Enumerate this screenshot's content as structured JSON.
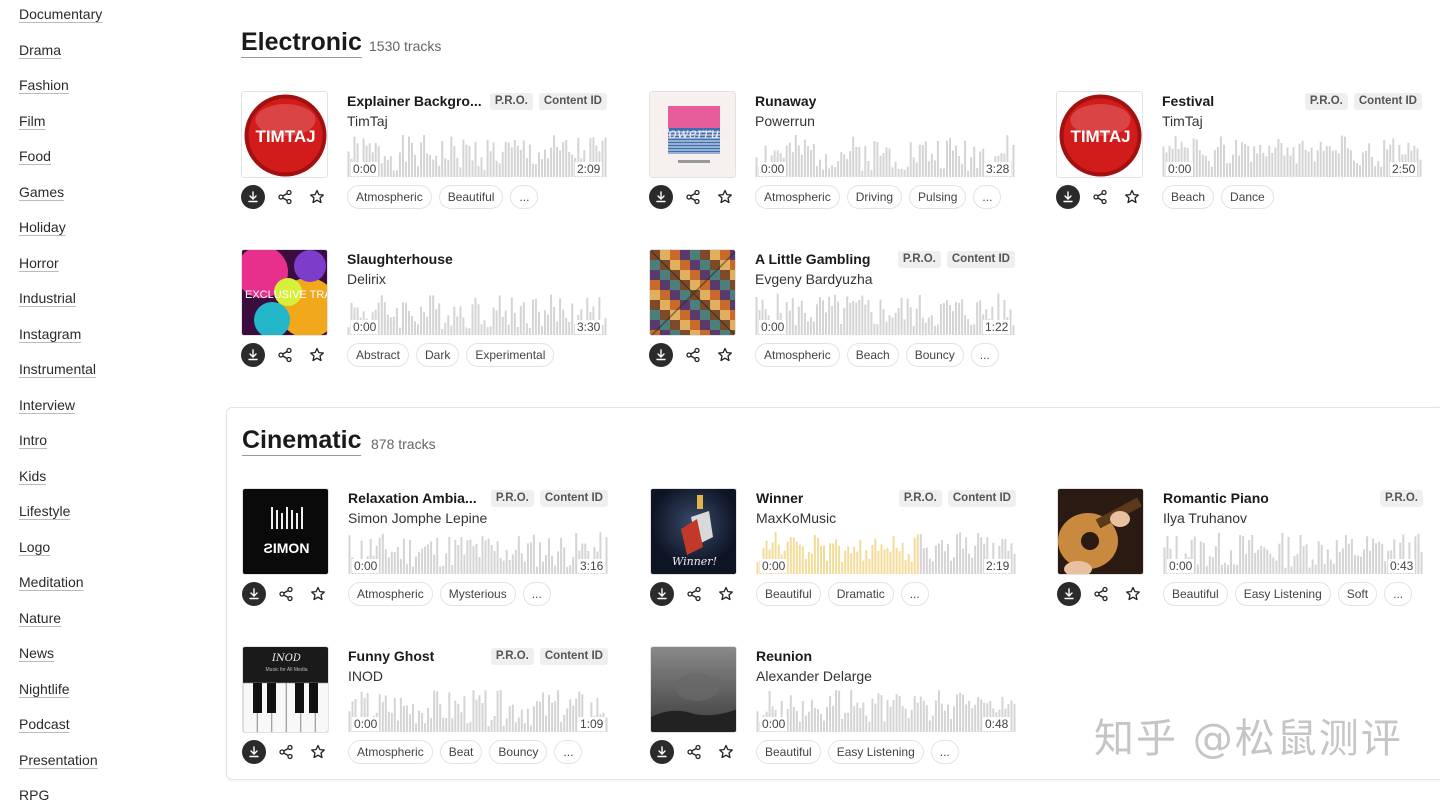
{
  "sidebar": {
    "items": [
      "Documentary",
      "Drama",
      "Fashion",
      "Film",
      "Food",
      "Games",
      "Holiday",
      "Horror",
      "Industrial",
      "Instagram",
      "Instrumental",
      "Interview",
      "Intro",
      "Kids",
      "Lifestyle",
      "Logo",
      "Meditation",
      "Nature",
      "News",
      "Nightlife",
      "Podcast",
      "Presentation",
      "RPG"
    ]
  },
  "sections": [
    {
      "title": "Electronic",
      "count": "1530 tracks",
      "tracks": [
        {
          "title": "Explainer Backgro...",
          "artist": "TimTaj",
          "badges": [
            "P.R.O.",
            "Content ID"
          ],
          "start": "0:00",
          "duration": "2:09",
          "tags": [
            "Atmospheric",
            "Beautiful",
            "..."
          ],
          "cover": "timtaj"
        },
        {
          "title": "Runaway",
          "artist": "Powerrun",
          "badges": [],
          "start": "0:00",
          "duration": "3:28",
          "tags": [
            "Atmospheric",
            "Driving",
            "Pulsing",
            "..."
          ],
          "cover": "runaway"
        },
        {
          "title": "Festival",
          "artist": "TimTaj",
          "badges": [
            "P.R.O.",
            "Content ID"
          ],
          "start": "0:00",
          "duration": "2:50",
          "tags": [
            "Beach",
            "Dance"
          ],
          "cover": "timtaj"
        },
        {
          "title": "Slaughterhouse",
          "artist": "Delirix",
          "badges": [],
          "start": "0:00",
          "duration": "3:30",
          "tags": [
            "Abstract",
            "Dark",
            "Experimental"
          ],
          "cover": "exclusive"
        },
        {
          "title": "A Little Gambling",
          "artist": "Evgeny Bardyuzha",
          "badges": [
            "P.R.O.",
            "Content ID"
          ],
          "start": "0:00",
          "duration": "1:22",
          "tags": [
            "Atmospheric",
            "Beach",
            "Bouncy",
            "..."
          ],
          "cover": "pattern"
        }
      ]
    },
    {
      "title": "Cinematic",
      "count": "878 tracks",
      "tracks": [
        {
          "title": "Relaxation Ambia...",
          "artist": "Simon Jomphe Lepine",
          "badges": [
            "P.R.O.",
            "Content ID"
          ],
          "start": "0:00",
          "duration": "3:16",
          "tags": [
            "Atmospheric",
            "Mysterious",
            "..."
          ],
          "cover": "simon"
        },
        {
          "title": "Winner",
          "artist": "MaxKoMusic",
          "badges": [
            "P.R.O.",
            "Content ID"
          ],
          "start": "0:00",
          "duration": "2:19",
          "tags": [
            "Beautiful",
            "Dramatic",
            "..."
          ],
          "cover": "winner"
        },
        {
          "title": "Romantic Piano",
          "artist": "Ilya Truhanov",
          "badges": [
            "P.R.O."
          ],
          "start": "0:00",
          "duration": "0:43",
          "tags": [
            "Beautiful",
            "Easy Listening",
            "Soft",
            "..."
          ],
          "cover": "guitar"
        },
        {
          "title": "Funny Ghost",
          "artist": "INOD",
          "badges": [
            "P.R.O.",
            "Content ID"
          ],
          "start": "0:00",
          "duration": "1:09",
          "tags": [
            "Atmospheric",
            "Beat",
            "Bouncy",
            "..."
          ],
          "cover": "piano"
        },
        {
          "title": "Reunion",
          "artist": "Alexander Delarge",
          "badges": [],
          "start": "0:00",
          "duration": "0:48",
          "tags": [
            "Beautiful",
            "Easy Listening",
            "..."
          ],
          "cover": "reunion"
        }
      ]
    }
  ],
  "cover_text": {
    "timtaj": "TIMTAJ",
    "runaway": "Powerrun",
    "exclusive": "EXCLUSIVE TRACK COLLECTION",
    "simon": "ƧIMON",
    "winner": "Winner!",
    "piano": "INOD",
    "piano_sub": "Music for All Media"
  },
  "watermark": "知乎 @松鼠测评",
  "colors": {
    "waveform": "#d4d4d4",
    "waveform_played": "#f3dc9a",
    "download_bg": "#2b2b2b"
  },
  "playback": {
    "Winner": 0.62
  }
}
